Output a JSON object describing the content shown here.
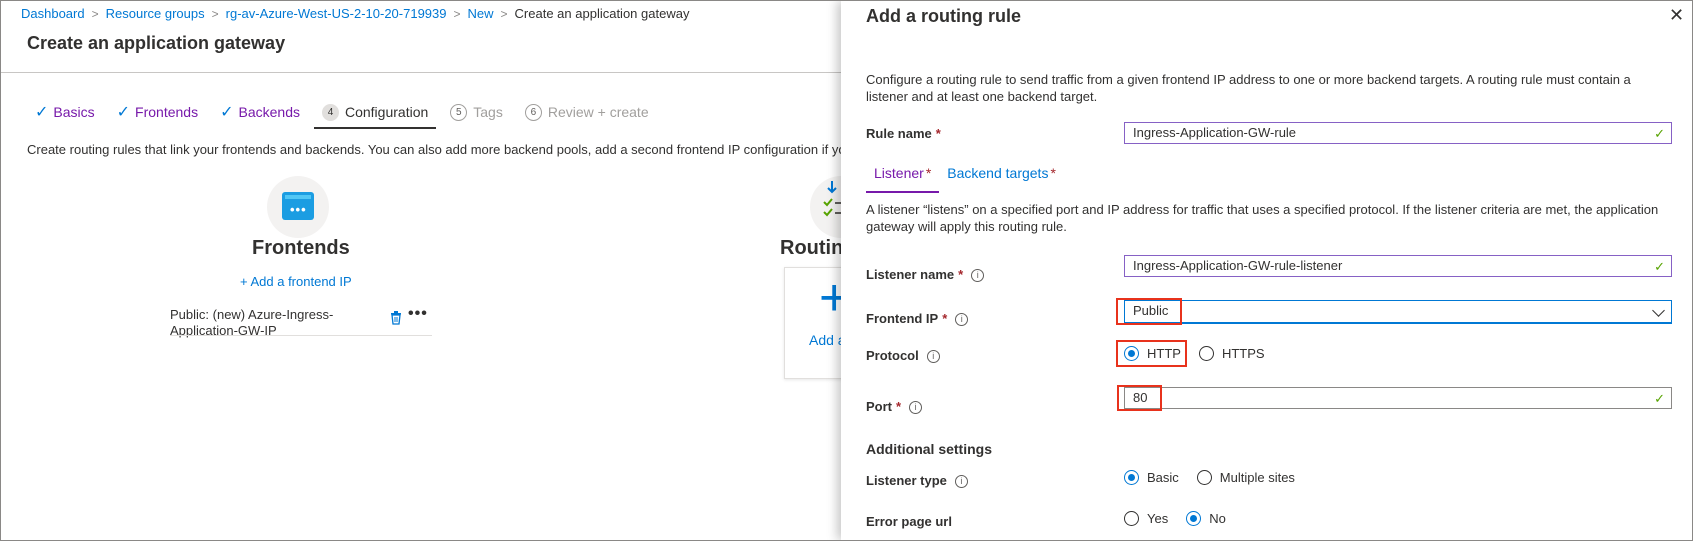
{
  "breadcrumb": [
    "Dashboard",
    "Resource groups",
    "rg-av-Azure-West-US-2-10-20-719939",
    "New"
  ],
  "breadcrumb_current": "Create an application gateway",
  "page_title": "Create an application gateway",
  "wizard_tabs": [
    {
      "label": "Basics",
      "state": "done"
    },
    {
      "label": "Frontends",
      "state": "done"
    },
    {
      "label": "Backends",
      "state": "done"
    },
    {
      "num": "4",
      "label": "Configuration",
      "state": "active"
    },
    {
      "num": "5",
      "label": "Tags",
      "state": "disabled"
    },
    {
      "num": "6",
      "label": "Review + create",
      "state": "disabled"
    }
  ],
  "description": "Create routing rules that link your frontends and backends. You can also add more backend pools, add a second frontend IP configuration if yo",
  "frontends": {
    "heading": "Frontends",
    "add_link": "+ Add a frontend IP",
    "item": "Public: (new) Azure-Ingress-Application-GW-IP"
  },
  "routing": {
    "heading": "Routin",
    "plus": "+",
    "add_label": "Add a"
  },
  "panel": {
    "title": "Add a routing rule",
    "close": "✕",
    "description": "Configure a routing rule to send traffic from a given frontend IP address to one or more backend targets. A routing rule must contain a listener and at least one backend target.",
    "rule_name_label": "Rule name",
    "rule_name_value": "Ingress-Application-GW-rule",
    "tabs": [
      "Listener",
      "Backend targets"
    ],
    "listener_desc": "A listener “listens” on a specified port and IP address for traffic that uses a specified protocol. If the listener criteria are met, the application gateway will apply this routing rule.",
    "listener_name_label": "Listener name",
    "listener_name_value": "Ingress-Application-GW-rule-listener",
    "frontend_ip_label": "Frontend IP",
    "frontend_ip_value": "Public",
    "protocol_label": "Protocol",
    "protocol_options": [
      "HTTP",
      "HTTPS"
    ],
    "protocol_selected": "HTTP",
    "port_label": "Port",
    "port_value": "80",
    "additional_settings": "Additional settings",
    "listener_type_label": "Listener type",
    "listener_type_options": [
      "Basic",
      "Multiple sites"
    ],
    "listener_type_selected": "Basic",
    "error_page_label": "Error page url",
    "error_page_options": [
      "Yes",
      "No"
    ],
    "error_page_selected": "No"
  },
  "required_mark": "*",
  "info_glyph": "i",
  "check_glyph": "✓",
  "colors": {
    "accent": "#0078d4",
    "valid_border": "#8661c5",
    "highlight": "#e8321c",
    "valid_check": "#57a300",
    "required": "#a4262c"
  }
}
